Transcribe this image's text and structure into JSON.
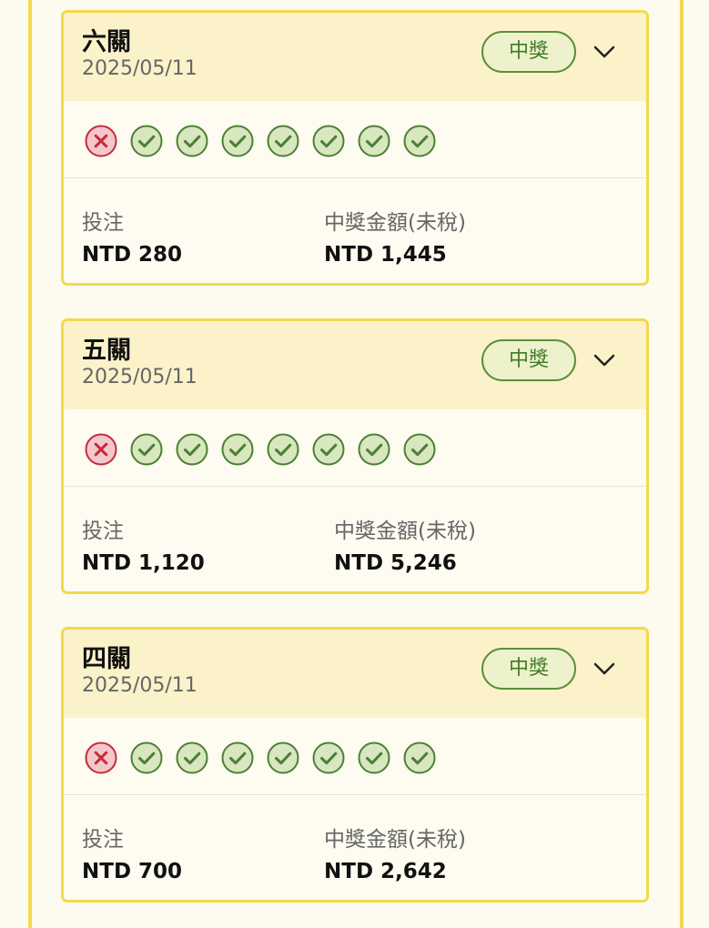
{
  "cards": [
    {
      "title": "六關",
      "date": "2025/05/11",
      "badge": "中獎",
      "results": [
        "lose",
        "win",
        "win",
        "win",
        "win",
        "win",
        "win",
        "win"
      ],
      "stake_label": "投注",
      "stake_value": "NTD 280",
      "payout_label": "中獎金額(未稅)",
      "payout_value": "NTD 1,445"
    },
    {
      "title": "五關",
      "date": "2025/05/11",
      "badge": "中獎",
      "results": [
        "lose",
        "win",
        "win",
        "win",
        "win",
        "win",
        "win",
        "win"
      ],
      "stake_label": "投注",
      "stake_value": "NTD 1,120",
      "payout_label": "中獎金額(未稅)",
      "payout_value": "NTD 5,246"
    },
    {
      "title": "四關",
      "date": "2025/05/11",
      "badge": "中獎",
      "results": [
        "lose",
        "win",
        "win",
        "win",
        "win",
        "win",
        "win",
        "win"
      ],
      "stake_label": "投注",
      "stake_value": "NTD 700",
      "payout_label": "中獎金額(未稅)",
      "payout_value": "NTD 2,642"
    }
  ],
  "icons": {
    "win": "check-circle-icon",
    "lose": "x-circle-icon",
    "expand": "chevron-down-icon"
  },
  "colors": {
    "accent_border": "#f2d94e",
    "header_bg": "#fcf2c9",
    "win_green": "#3f7b27",
    "lose_red": "#c52b3b"
  }
}
